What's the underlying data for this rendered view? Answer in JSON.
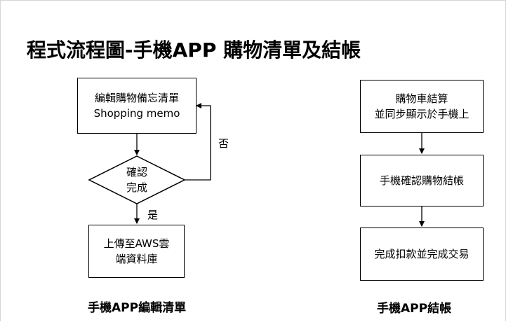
{
  "title": "程式流程圖-手機APP 購物清單及結帳",
  "left_flow": {
    "edit_box": [
      "編輯購物備忘清單",
      "Shopping memo"
    ],
    "decision": [
      "確認",
      "完成"
    ],
    "no_label": "否",
    "yes_label": "是",
    "upload_box": [
      "上傳至AWS雲",
      "端資料庫"
    ],
    "caption": "手機APP編輯清單"
  },
  "right_flow": {
    "cart_box": [
      "購物車結算",
      "並同步顯示於手機上"
    ],
    "confirm_box": [
      "手機確認購物結帳"
    ],
    "done_box": [
      "完成扣款並完成交易"
    ],
    "caption": "手機APP結帳"
  }
}
